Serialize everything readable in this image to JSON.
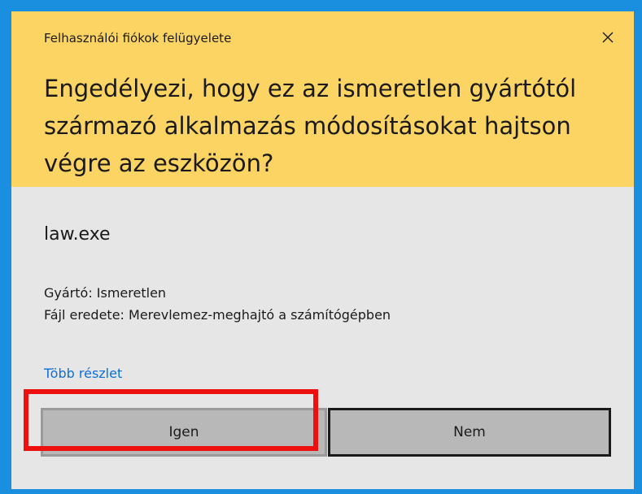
{
  "dialog": {
    "window_title": "Felhasználói fiókok felügyelete",
    "close_icon": "close-icon",
    "question": "Engedélyezi, hogy ez az ismeretlen gyártótól származó alkalmazás módosításokat hajtson végre az eszközön?",
    "app_name": "law.exe",
    "publisher_line": "Gyártó: Ismeretlen",
    "origin_line": "Fájl eredete: Merevlemez-meghajtó a számítógépben",
    "more_details_link": "Több részlet",
    "yes_button": "Igen",
    "no_button": "Nem"
  },
  "colors": {
    "accent_border": "#1a8fe0",
    "header_bg": "#fcd463",
    "body_bg": "#e6e6e6",
    "link": "#0a6fd6",
    "button_bg": "#b8b8b8",
    "highlight": "#ee0f0f"
  }
}
